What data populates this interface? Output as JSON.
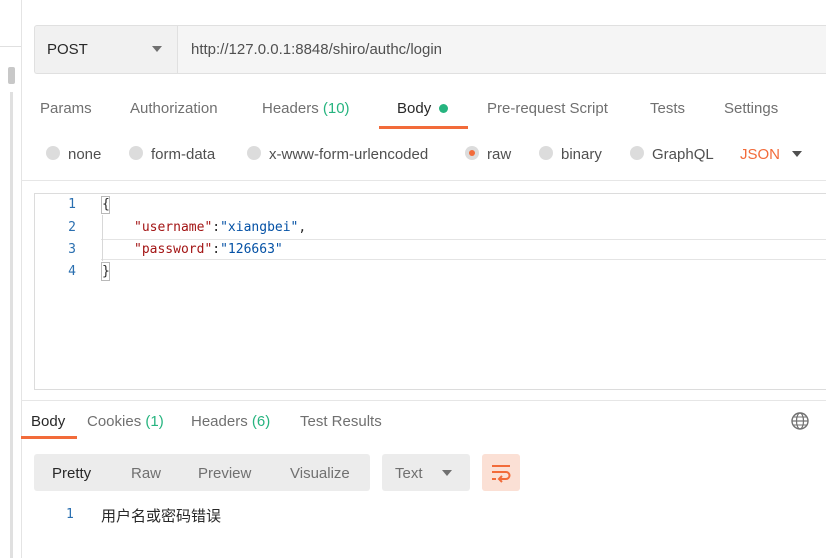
{
  "request": {
    "method": "POST",
    "url": "http://127.0.0.1:8848/shiro/authc/login"
  },
  "request_tabs": {
    "params": "Params",
    "authorization": "Authorization",
    "headers": "Headers",
    "headers_count": "(10)",
    "body": "Body",
    "pre_request_script": "Pre-request Script",
    "tests": "Tests",
    "settings": "Settings"
  },
  "body_types": {
    "none": "none",
    "form_data": "form-data",
    "urlencoded": "x-www-form-urlencoded",
    "raw": "raw",
    "binary": "binary",
    "graphql": "GraphQL",
    "selected_format": "JSON"
  },
  "editor": {
    "line_numbers": [
      "1",
      "2",
      "3",
      "4"
    ],
    "line1": "{",
    "line2_key": "\"username\"",
    "line2_sep": ":",
    "line2_val": "\"xiangbei\"",
    "line2_end": ",",
    "line3_key": "\"password\"",
    "line3_sep": ":",
    "line3_val": "\"126663\"",
    "line4": "}"
  },
  "response_tabs": {
    "body": "Body",
    "cookies": "Cookies",
    "cookies_count": "(1)",
    "headers": "Headers",
    "headers_count": "(6)",
    "test_results": "Test Results"
  },
  "response_toolbar": {
    "pretty": "Pretty",
    "raw": "Raw",
    "preview": "Preview",
    "visualize": "Visualize",
    "format": "Text"
  },
  "response_body": {
    "line_number": "1",
    "text": "用户名或密码错误"
  },
  "icons": {
    "method_caret": "chevron-down-icon",
    "format_caret": "chevron-down-icon",
    "globe": "globe-icon",
    "wrap": "wrap-lines-icon"
  },
  "colors": {
    "accent": "#f26b3a",
    "count_green": "#26b47f"
  }
}
